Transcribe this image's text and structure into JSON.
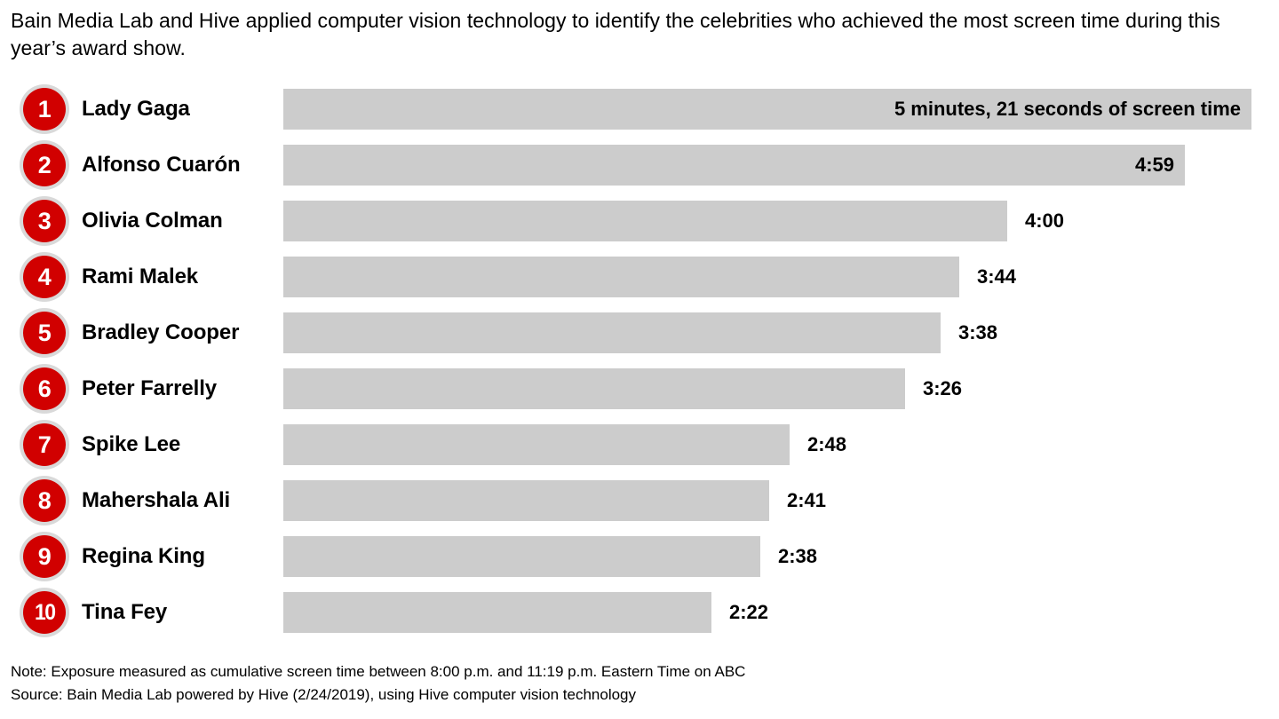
{
  "headline": "Bain Media Lab and Hive applied computer vision technology to identify the celebrities who achieved the most screen time during this year’s award show.",
  "colors": {
    "badge_fill": "#d10000",
    "badge_ring": "#d9d9d9",
    "bar_fill": "#cccccc",
    "text": "#000000",
    "background": "#ffffff"
  },
  "footnotes": {
    "note": "Note: Exposure measured as cumulative screen time between 8:00 p.m. and 11:19 p.m. Eastern Time on ABC",
    "source": "Source: Bain Media Lab powered by Hive (2/24/2019), using Hive computer vision technology"
  },
  "chart_data": {
    "type": "bar",
    "orientation": "horizontal",
    "title": "Bain Media Lab and Hive applied computer vision technology to identify the celebrities who achieved the most screen time during this year’s award show.",
    "xlabel": "",
    "ylabel": "",
    "grid": false,
    "legend": "none",
    "value_unit": "minutes:seconds of screen time",
    "xlim": [
      0,
      321
    ],
    "categories": [
      "Lady Gaga",
      "Alfonso Cuarón",
      "Olivia Colman",
      "Rami Malek",
      "Bradley Cooper",
      "Peter Farrelly",
      "Spike Lee",
      "Mahershala Ali",
      "Regina King",
      "Tina Fey"
    ],
    "values": [
      321,
      299,
      240,
      224,
      218,
      206,
      168,
      161,
      158,
      142
    ],
    "value_labels": [
      "5 minutes, 21 seconds of screen time",
      "4:59",
      "4:00",
      "3:44",
      "3:38",
      "3:26",
      "2:48",
      "2:41",
      "2:38",
      "2:22"
    ],
    "ranks": [
      "1",
      "2",
      "3",
      "4",
      "5",
      "6",
      "7",
      "8",
      "9",
      "10"
    ],
    "label_placement": [
      "inside",
      "inside",
      "outside",
      "outside",
      "outside",
      "outside",
      "outside",
      "outside",
      "outside",
      "outside"
    ]
  }
}
